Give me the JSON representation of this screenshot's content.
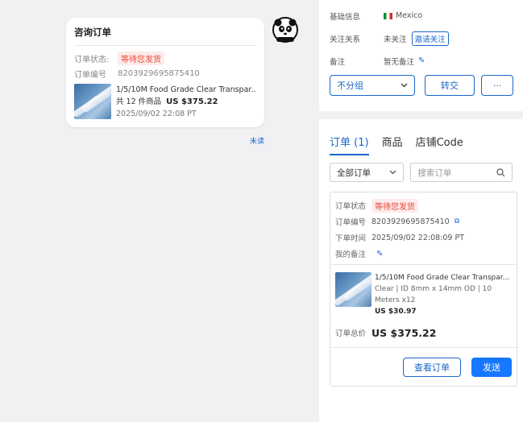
{
  "chat": {
    "card": {
      "title": "咨询订单",
      "status_label": "订单状态:",
      "status_value": "等待您发货",
      "order_no_label": "订单编号",
      "order_no": "8203929695875410",
      "product_name": "1/5/10M Food Grade Clear Transpar...",
      "count_text": "共 12 件商品",
      "price": "US $375.22",
      "date": "2025/09/02 22:08 PT"
    },
    "unread_label": "未读",
    "avatar_icon": "panda-avatar-icon"
  },
  "side": {
    "basic_label": "基础信息",
    "country": "Mexico",
    "relation_label": "关注关系",
    "relation_value": "未关注",
    "invite_button": "邀请关注",
    "note_label": "备注",
    "note_value": "暂无备注",
    "group_select": "不分组",
    "transfer_button": "转交",
    "more_button": "···",
    "tabs": [
      "订单 (1)",
      "商品",
      "店铺Code"
    ],
    "filter_select": "全部订单",
    "search_placeholder": "搜索订单",
    "order": {
      "status_label": "订单状态",
      "status_value": "等待您发货",
      "order_no_label": "订单编号",
      "order_no": "8203929695875410",
      "time_label": "下单时间",
      "time_value": "2025/09/02 22:08:09 PT",
      "note_label": "我的备注",
      "product_name": "1/5/10M Food Grade Clear Transpar...",
      "spec": "Clear | ID 8mm x 14mm OD | 10 Meters x12",
      "unit_price": "US $30.97",
      "total_label": "订单总价",
      "total_value": "US $375.22",
      "view_button": "查看订单",
      "send_button": "发送"
    }
  },
  "colors": {
    "accent": "#1a66c9",
    "primary_button": "#1677ff",
    "status_red": "#e8483b"
  }
}
